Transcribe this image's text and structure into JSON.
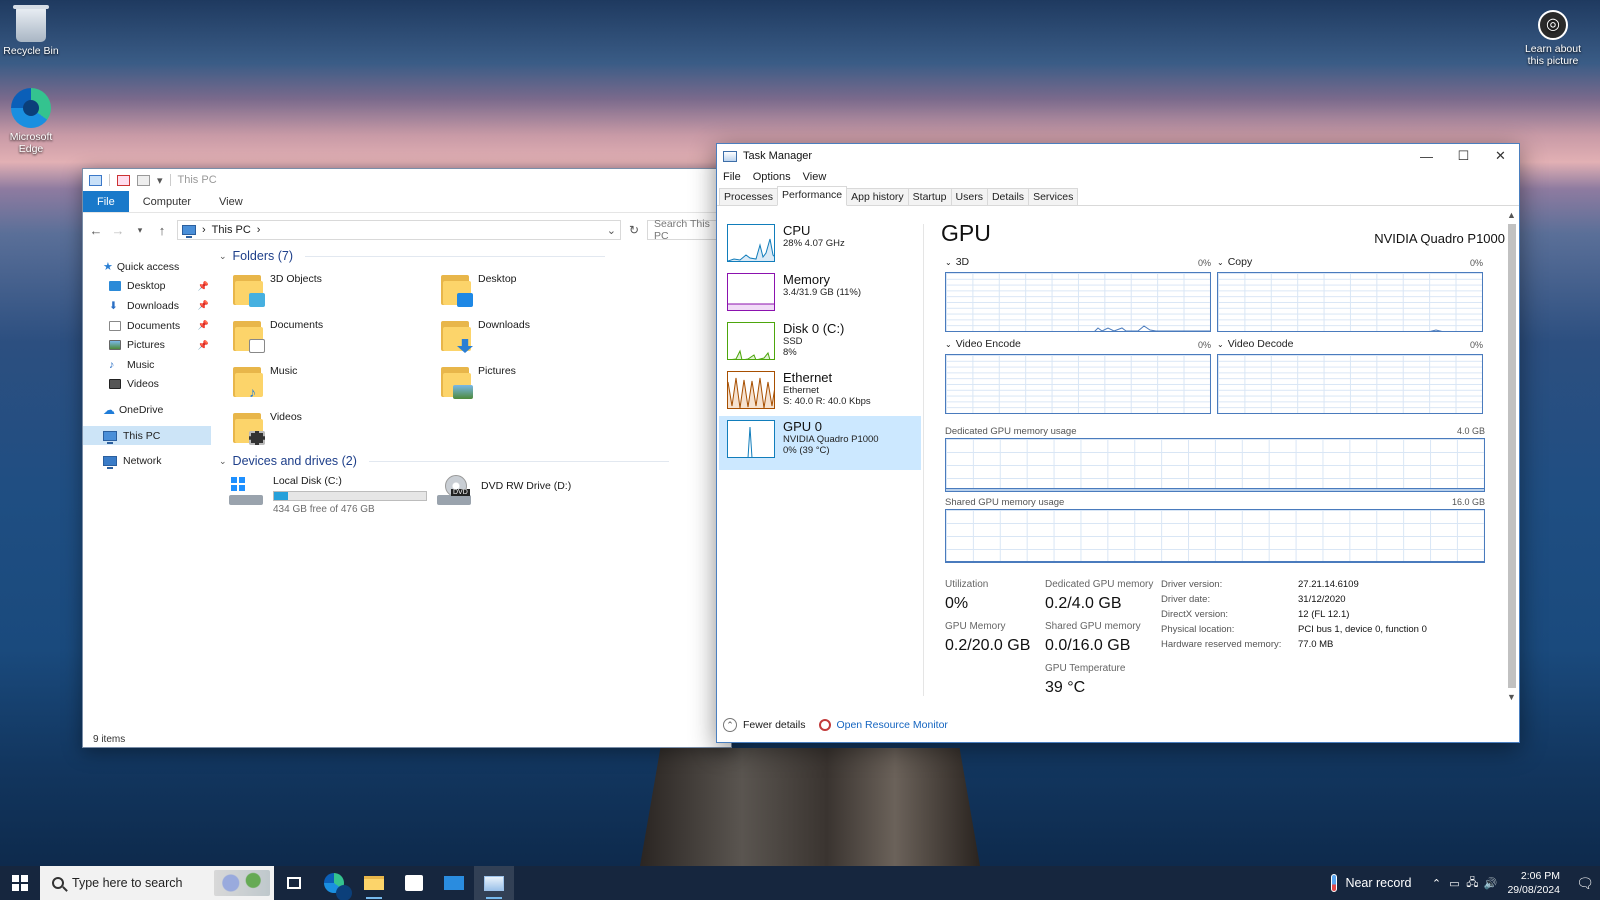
{
  "desktop": {
    "icons": [
      {
        "label": "Recycle Bin"
      },
      {
        "label": "Microsoft Edge"
      },
      {
        "label": "Learn about this picture"
      }
    ]
  },
  "explorer": {
    "title": "This PC",
    "ribbon_tabs": [
      "File",
      "Computer",
      "View"
    ],
    "breadcrumb": "This PC",
    "search_placeholder": "Search This PC",
    "nav": [
      {
        "label": "Quick access",
        "pinned": false
      },
      {
        "label": "Desktop",
        "pinned": true
      },
      {
        "label": "Downloads",
        "pinned": true
      },
      {
        "label": "Documents",
        "pinned": true
      },
      {
        "label": "Pictures",
        "pinned": true
      },
      {
        "label": "Music",
        "pinned": false
      },
      {
        "label": "Videos",
        "pinned": false
      },
      {
        "label": "OneDrive",
        "pinned": false
      },
      {
        "label": "This PC",
        "pinned": false
      },
      {
        "label": "Network",
        "pinned": false
      }
    ],
    "folders_header": "Folders (7)",
    "folders": [
      "3D Objects",
      "Desktop",
      "Documents",
      "Downloads",
      "Music",
      "Pictures",
      "Videos"
    ],
    "drives_header": "Devices and drives (2)",
    "drives": [
      {
        "name": "Local Disk (C:)",
        "free": "434 GB free of 476 GB",
        "used_fraction": 0.09
      },
      {
        "name": "DVD RW Drive (D:)"
      }
    ],
    "status": "9 items"
  },
  "taskmgr": {
    "title": "Task Manager",
    "menu": [
      "File",
      "Options",
      "View"
    ],
    "tabs": [
      "Processes",
      "Performance",
      "App history",
      "Startup",
      "Users",
      "Details",
      "Services"
    ],
    "active_tab": "Performance",
    "side": [
      {
        "name": "CPU",
        "sub1": "28%  4.07 GHz",
        "sub2": "",
        "color": "#117dbb"
      },
      {
        "name": "Memory",
        "sub1": "3.4/31.9 GB (11%)",
        "sub2": "",
        "color": "#8b12ae"
      },
      {
        "name": "Disk 0 (C:)",
        "sub1": "SSD",
        "sub2": "8%",
        "color": "#4da60c"
      },
      {
        "name": "Ethernet",
        "sub1": "Ethernet",
        "sub2": "S: 40.0  R: 40.0 Kbps",
        "color": "#a74f01"
      },
      {
        "name": "GPU 0",
        "sub1": "NVIDIA Quadro P1000",
        "sub2": "0% (39 °C)",
        "color": "#117dbb"
      }
    ],
    "gpu_title": "GPU",
    "gpu_model": "NVIDIA Quadro P1000",
    "graphs": [
      {
        "label": "3D",
        "pct": "0%"
      },
      {
        "label": "Copy",
        "pct": "0%"
      },
      {
        "label": "Video Encode",
        "pct": "0%"
      },
      {
        "label": "Video Decode",
        "pct": "0%"
      }
    ],
    "dedicated_label": "Dedicated GPU memory usage",
    "dedicated_max": "4.0 GB",
    "shared_label": "Shared GPU memory usage",
    "shared_max": "16.0 GB",
    "stats": {
      "utilization_label": "Utilization",
      "utilization": "0%",
      "dedicated_mem_label": "Dedicated GPU memory",
      "dedicated_mem": "0.2/4.0 GB",
      "gpu_mem_label": "GPU Memory",
      "gpu_mem": "0.2/20.0 GB",
      "shared_mem_label": "Shared GPU memory",
      "shared_mem": "0.0/16.0 GB",
      "temp_label": "GPU Temperature",
      "temp": "39 °C"
    },
    "info": [
      {
        "k": "Driver version:",
        "v": "27.21.14.6109"
      },
      {
        "k": "Driver date:",
        "v": "31/12/2020"
      },
      {
        "k": "DirectX version:",
        "v": "12 (FL 12.1)"
      },
      {
        "k": "Physical location:",
        "v": "PCI bus 1, device 0, function 0"
      },
      {
        "k": "Hardware reserved memory:",
        "v": "77.0 MB"
      }
    ],
    "fewer_details": "Fewer details",
    "open_resmon": "Open Resource Monitor"
  },
  "taskbar": {
    "search_placeholder": "Type here to search",
    "weather": "Near record",
    "time": "2:06 PM",
    "date": "29/08/2024"
  }
}
